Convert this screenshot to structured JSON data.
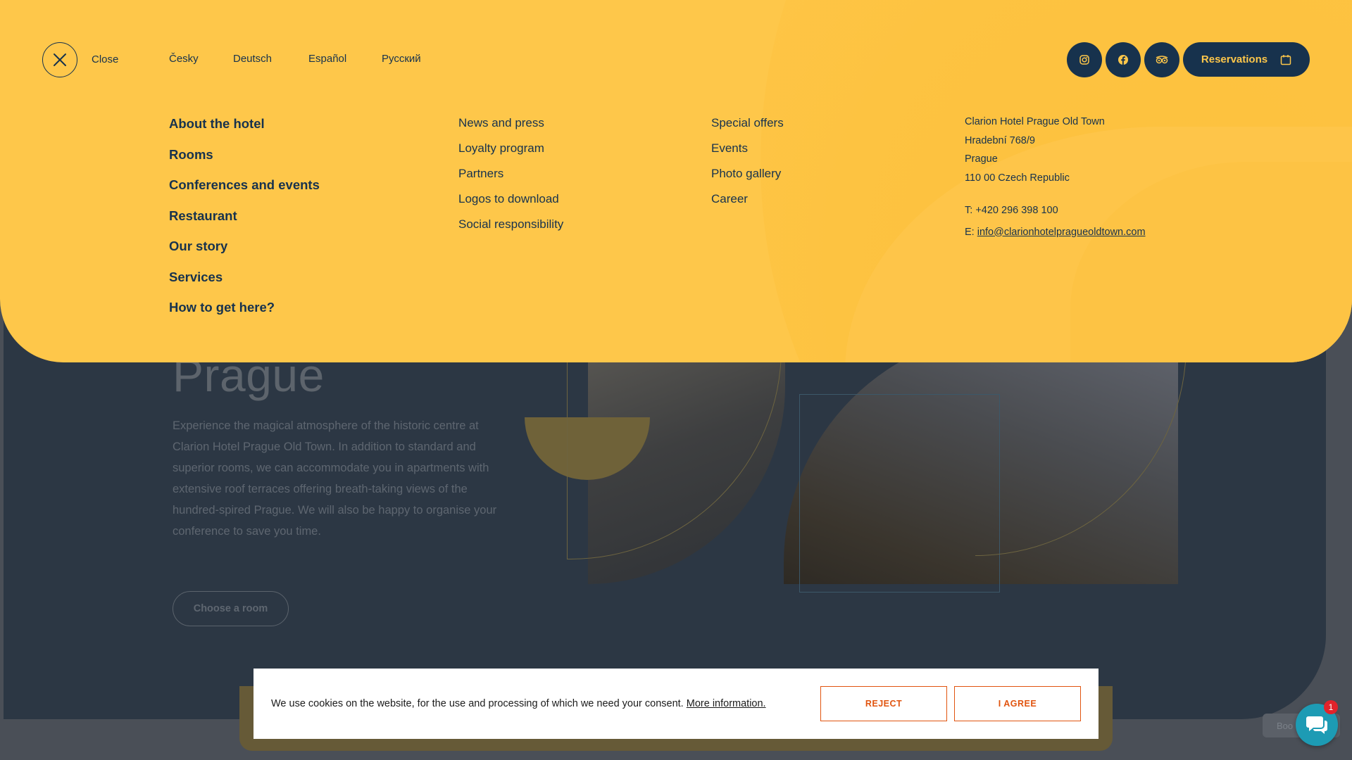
{
  "hero": {
    "title": "Prague",
    "description": "Experience the magical atmosphere of the historic centre at Clarion Hotel Prague Old Town. In addition to standard and superior rooms, we can accommodate you in apartments with extensive roof terraces offering breath-taking views of the hundred-spired Prague. We will also be happy to organise your conference to save you time.",
    "cta_label": "Choose a room",
    "side_button_label": "Boo"
  },
  "menu": {
    "close_label": "Close",
    "languages": [
      "Česky",
      "Deutsch",
      "Español",
      "Русский"
    ],
    "social_icons": [
      "instagram-icon",
      "facebook-icon",
      "tripadvisor-icon"
    ],
    "reservations_label": "Reservations",
    "main_links": [
      "About the hotel",
      "Rooms",
      "Conferences and events",
      "Restaurant",
      "Our story",
      "Services",
      "How to get here?"
    ],
    "links_col2": [
      "News and press",
      "Loyalty program",
      "Partners",
      "Logos to download",
      "Social responsibility"
    ],
    "links_col3": [
      "Special offers",
      "Events",
      "Photo gallery",
      "Career"
    ],
    "contact": {
      "name": "Clarion Hotel Prague Old Town",
      "street": "Hradební 768/9",
      "city": "Prague",
      "zip_country": "110 00 Czech Republic",
      "phone_prefix": "T: ",
      "phone": "+420 296 398 100",
      "email_prefix": "E: ",
      "email": "info@clarionhotelpragueoldtown.com"
    }
  },
  "cookie": {
    "text": "We use cookies on the website, for the use and processing of which we need your consent.",
    "more_info": "More information.",
    "reject_label": "REJECT",
    "agree_label": "I AGREE"
  },
  "chat": {
    "badge_count": "1"
  },
  "colors": {
    "menu_bg": "#fec74a",
    "navy": "#17324d",
    "accent_orange": "#e1540f",
    "chat_teal": "#1d9bb4"
  }
}
